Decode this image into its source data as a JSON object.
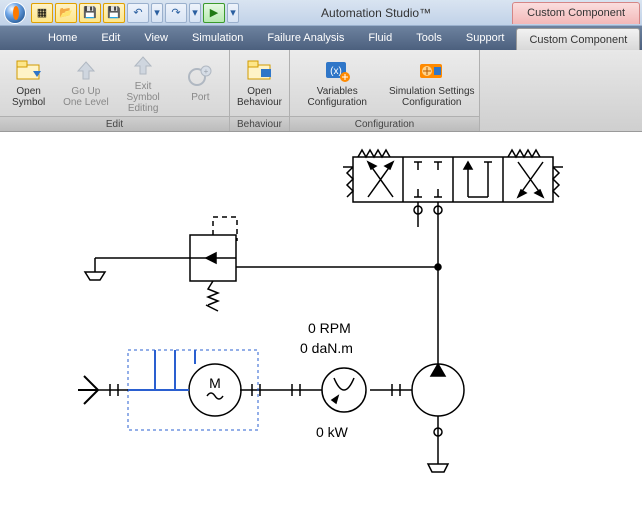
{
  "title": "Automation Studio™",
  "title_right": "Custom Component",
  "tabs": [
    "Home",
    "Edit",
    "View",
    "Simulation",
    "Failure Analysis",
    "Fluid",
    "Tools",
    "Support",
    "Custom Component"
  ],
  "active_tab": 8,
  "ribbon": {
    "edit": {
      "label": "Edit",
      "open_symbol": "Open\nSymbol",
      "go_up": "Go Up\nOne Level",
      "exit_symbol": "Exit Symbol\nEditing",
      "port": "Port"
    },
    "behaviour": {
      "label": "Behaviour",
      "open_behaviour": "Open\nBehaviour"
    },
    "configuration": {
      "label": "Configuration",
      "variables": "Variables\nConfiguration",
      "sim_settings": "Simulation Settings\nConfiguration"
    }
  },
  "readings": {
    "rpm": "0 RPM",
    "torque": "0 daN.m",
    "power": "0 kW"
  }
}
